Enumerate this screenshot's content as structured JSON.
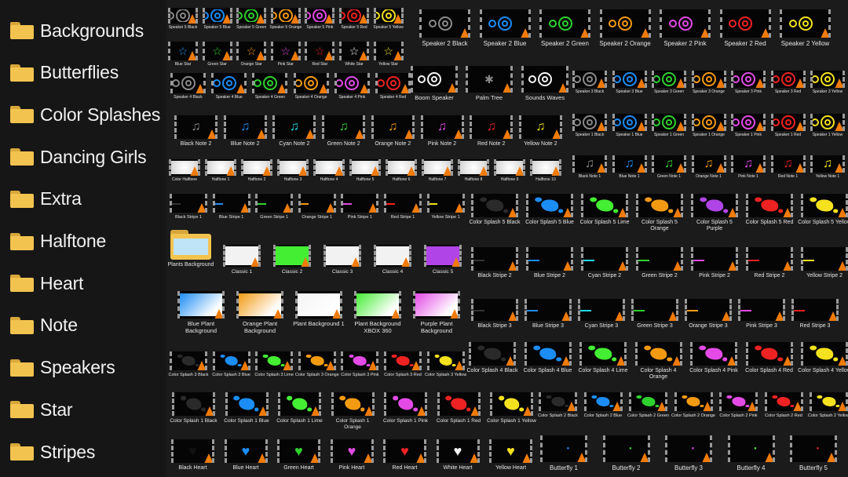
{
  "sidebar": {
    "folders": [
      "Backgrounds",
      "Butterflies",
      "Color Splashes",
      "Dancing Girls",
      "Extra",
      "Halftone",
      "Heart",
      "Note",
      "Speakers",
      "Star",
      "Stripes"
    ]
  },
  "colors": {
    "Black": "#0a0a0a",
    "Blue": "#1c8df5",
    "Green": "#2fd12f",
    "Orange": "#f39a12",
    "Pink": "#e34ae6",
    "Red": "#ee2222",
    "White": "#f4f4f4",
    "Yellow": "#f4e21e",
    "Cyan": "#22d8e8",
    "Lime": "#44ee33",
    "Purple": "#b144e6"
  },
  "tiles": [
    {
      "label": "Speaker 5 Black",
      "kind": "rings",
      "color": "Black"
    },
    {
      "label": "Speaker 5 Blue",
      "kind": "rings",
      "color": "Blue"
    },
    {
      "label": "Speaker 5 Green",
      "kind": "rings",
      "color": "Green"
    },
    {
      "label": "Speaker 5 Orange",
      "kind": "rings",
      "color": "Orange"
    },
    {
      "label": "Speaker 5 Pink",
      "kind": "rings",
      "color": "Pink"
    },
    {
      "label": "Speaker 5 Red",
      "kind": "rings",
      "color": "Red"
    },
    {
      "label": "Speaker 5 Yellow",
      "kind": "rings",
      "color": "Yellow"
    },
    {
      "label": "Blue Star",
      "kind": "star",
      "color": "Blue"
    },
    {
      "label": "Green Star",
      "kind": "star",
      "color": "Green"
    },
    {
      "label": "Orange Star",
      "kind": "star",
      "color": "Orange"
    },
    {
      "label": "Pink Star",
      "kind": "star",
      "color": "Pink"
    },
    {
      "label": "Red Star",
      "kind": "star",
      "color": "Red"
    },
    {
      "label": "White Star",
      "kind": "star",
      "color": "White"
    },
    {
      "label": "Yellow Star",
      "kind": "star",
      "color": "Yellow"
    },
    {
      "label": "Speaker 2 Black",
      "kind": "rings",
      "color": "Black"
    },
    {
      "label": "Speaker 2 Blue",
      "kind": "rings",
      "color": "Blue"
    },
    {
      "label": "Speaker 2 Green",
      "kind": "rings",
      "color": "Green"
    },
    {
      "label": "Speaker 2 Orange",
      "kind": "rings",
      "color": "Orange"
    },
    {
      "label": "Speaker 2 Pink",
      "kind": "rings",
      "color": "Pink"
    },
    {
      "label": "Speaker 2 Red",
      "kind": "rings",
      "color": "Red"
    },
    {
      "label": "Speaker 2 Yellow",
      "kind": "rings",
      "color": "Yellow"
    },
    {
      "label": "Speaker 4 Black",
      "kind": "rings",
      "color": "Black"
    },
    {
      "label": "Speaker 4 Blue",
      "kind": "rings",
      "color": "Blue"
    },
    {
      "label": "Speaker 4 Green",
      "kind": "rings",
      "color": "Green"
    },
    {
      "label": "Speaker 4 Orange",
      "kind": "rings",
      "color": "Orange"
    },
    {
      "label": "Speaker 4 Pink",
      "kind": "rings",
      "color": "Pink"
    },
    {
      "label": "Speaker 4 Red",
      "kind": "rings",
      "color": "Red"
    },
    {
      "label": "Boom Speaker",
      "kind": "rings",
      "color": "White"
    },
    {
      "label": "Palm Tree",
      "kind": "tree",
      "color": "White"
    },
    {
      "label": "Sounds Waves",
      "kind": "rings",
      "color": "White"
    },
    {
      "label": "Speaker 3 Black",
      "kind": "rings",
      "color": "Black"
    },
    {
      "label": "Speaker 3 Blue",
      "kind": "rings",
      "color": "Blue"
    },
    {
      "label": "Speaker 3 Green",
      "kind": "rings",
      "color": "Green"
    },
    {
      "label": "Speaker 3 Orange",
      "kind": "rings",
      "color": "Orange"
    },
    {
      "label": "Speaker 3 Pink",
      "kind": "rings",
      "color": "Pink"
    },
    {
      "label": "Speaker 3 Red",
      "kind": "rings",
      "color": "Red"
    },
    {
      "label": "Speaker 3 Yellow",
      "kind": "rings",
      "color": "Yellow"
    },
    {
      "label": "Black Note 2",
      "kind": "note",
      "color": "Black"
    },
    {
      "label": "Blue Note 2",
      "kind": "note",
      "color": "Blue"
    },
    {
      "label": "Cyan Note 2",
      "kind": "note",
      "color": "Cyan"
    },
    {
      "label": "Green Note 2",
      "kind": "note",
      "color": "Green"
    },
    {
      "label": "Orange Note 2",
      "kind": "note",
      "color": "Orange"
    },
    {
      "label": "Pink Note 2",
      "kind": "note",
      "color": "Pink"
    },
    {
      "label": "Red Note 2",
      "kind": "note",
      "color": "Red"
    },
    {
      "label": "Yellow Note 2",
      "kind": "note",
      "color": "Yellow"
    },
    {
      "label": "Speaker 1 Black",
      "kind": "rings",
      "color": "Black"
    },
    {
      "label": "Speaker 1 Blue",
      "kind": "rings",
      "color": "Blue"
    },
    {
      "label": "Speaker 1 Green",
      "kind": "rings",
      "color": "Green"
    },
    {
      "label": "Speaker 1 Orange",
      "kind": "rings",
      "color": "Orange"
    },
    {
      "label": "Speaker 1 Pink",
      "kind": "rings",
      "color": "Pink"
    },
    {
      "label": "Speaker 1 Red",
      "kind": "rings",
      "color": "Red"
    },
    {
      "label": "Speaker 1 Yellow",
      "kind": "rings",
      "color": "Yellow"
    },
    {
      "label": "Color Halftone",
      "kind": "half",
      "color": "White"
    },
    {
      "label": "Halftone 1",
      "kind": "half",
      "color": "White"
    },
    {
      "label": "Halftone 2",
      "kind": "half",
      "color": "White"
    },
    {
      "label": "Halftone 3",
      "kind": "half",
      "color": "White"
    },
    {
      "label": "Halftone 4",
      "kind": "half",
      "color": "White"
    },
    {
      "label": "Halftone 5",
      "kind": "half",
      "color": "White"
    },
    {
      "label": "Halftone 6",
      "kind": "half",
      "color": "White"
    },
    {
      "label": "Halftone 7",
      "kind": "half",
      "color": "White"
    },
    {
      "label": "Halftone 8",
      "kind": "half",
      "color": "White"
    },
    {
      "label": "Halftone 9",
      "kind": "half",
      "color": "White"
    },
    {
      "label": "Halftone 10",
      "kind": "half",
      "color": "White"
    },
    {
      "label": "Black Note 1",
      "kind": "note",
      "color": "Black"
    },
    {
      "label": "Blue Note 1",
      "kind": "note",
      "color": "Blue"
    },
    {
      "label": "Green Note 1",
      "kind": "note",
      "color": "Green"
    },
    {
      "label": "Orange Note 1",
      "kind": "note",
      "color": "Orange"
    },
    {
      "label": "Pink Note 1",
      "kind": "note",
      "color": "Pink"
    },
    {
      "label": "Red Note 1",
      "kind": "note",
      "color": "Red"
    },
    {
      "label": "Yellow Note 1",
      "kind": "note",
      "color": "Yellow"
    },
    {
      "label": "Black Stripe 1",
      "kind": "stripe",
      "color": "Black"
    },
    {
      "label": "Blue Stripe 1",
      "kind": "stripe",
      "color": "Blue"
    },
    {
      "label": "Green Stripe 1",
      "kind": "stripe",
      "color": "Green"
    },
    {
      "label": "Orange Stripe 1",
      "kind": "stripe",
      "color": "Orange"
    },
    {
      "label": "Pink Stripe 1",
      "kind": "stripe",
      "color": "Pink"
    },
    {
      "label": "Red Stripe 1",
      "kind": "stripe",
      "color": "Red"
    },
    {
      "label": "Yellow Stripe 1",
      "kind": "stripe",
      "color": "Yellow"
    },
    {
      "label": "Color Splash 5 Black",
      "kind": "splash",
      "color": "Black"
    },
    {
      "label": "Color Splash 5 Blue",
      "kind": "splash",
      "color": "Blue"
    },
    {
      "label": "Color Splash 5 Lime",
      "kind": "splash",
      "color": "Lime"
    },
    {
      "label": "Color Splash 5 Orange",
      "kind": "splash",
      "color": "Orange"
    },
    {
      "label": "Color Splash 5 Purple",
      "kind": "splash",
      "color": "Purple"
    },
    {
      "label": "Color Splash 5 Red",
      "kind": "splash",
      "color": "Red"
    },
    {
      "label": "Color Splash 5 Yellow",
      "kind": "splash",
      "color": "Yellow"
    },
    {
      "label": "Plants Background",
      "kind": "folder",
      "color": "White"
    },
    {
      "label": "Classic 1",
      "kind": "classic",
      "color": "White"
    },
    {
      "label": "Classic 2",
      "kind": "classic",
      "color": "Lime"
    },
    {
      "label": "Classic 3",
      "kind": "classic",
      "color": "White"
    },
    {
      "label": "Classic 4",
      "kind": "classic",
      "color": "White"
    },
    {
      "label": "Classic 5",
      "kind": "classic",
      "color": "Purple"
    },
    {
      "label": "Black Stripe 2",
      "kind": "stripe",
      "color": "Black"
    },
    {
      "label": "Blue Stripe 2",
      "kind": "stripe",
      "color": "Blue"
    },
    {
      "label": "Cyan Stripe 2",
      "kind": "stripe",
      "color": "Cyan"
    },
    {
      "label": "Green Stripe 2",
      "kind": "stripe",
      "color": "Green"
    },
    {
      "label": "Pink Stripe 2",
      "kind": "stripe",
      "color": "Pink"
    },
    {
      "label": "Red Stripe 2",
      "kind": "stripe",
      "color": "Red"
    },
    {
      "label": "Yellow Stripe 2",
      "kind": "stripe",
      "color": "Yellow"
    },
    {
      "label": "Blue Plant Background",
      "kind": "plant",
      "color": "Blue"
    },
    {
      "label": "Orange Plant Background",
      "kind": "plant",
      "color": "Orange"
    },
    {
      "label": "Plant Background 1",
      "kind": "plant",
      "color": "White"
    },
    {
      "label": "Plant Background XBOX 360",
      "kind": "plant",
      "color": "Lime"
    },
    {
      "label": "Purple Plant Background",
      "kind": "plant",
      "color": "Pink"
    },
    {
      "label": "Black Stripe 3",
      "kind": "stripe",
      "color": "Black"
    },
    {
      "label": "Blue Stripe 3",
      "kind": "stripe",
      "color": "Blue"
    },
    {
      "label": "Cyan Stripe 3",
      "kind": "stripe",
      "color": "Cyan"
    },
    {
      "label": "Green Stripe 3",
      "kind": "stripe",
      "color": "Green"
    },
    {
      "label": "Orange Stripe 3",
      "kind": "stripe",
      "color": "Orange"
    },
    {
      "label": "Pink Stripe 3",
      "kind": "stripe",
      "color": "Pink"
    },
    {
      "label": "Red Stripe 3",
      "kind": "stripe",
      "color": "Red"
    },
    {
      "label": "Color Splash 4 Black",
      "kind": "splash",
      "color": "Black"
    },
    {
      "label": "Color Splash 4 Blue",
      "kind": "splash",
      "color": "Blue"
    },
    {
      "label": "Color Splash 4 Lime",
      "kind": "splash",
      "color": "Lime"
    },
    {
      "label": "Color Splash 4 Orange",
      "kind": "splash",
      "color": "Orange"
    },
    {
      "label": "Color Splash 4 Pink",
      "kind": "splash",
      "color": "Pink"
    },
    {
      "label": "Color Splash 4 Red",
      "kind": "splash",
      "color": "Red"
    },
    {
      "label": "Color Splash 4 Yellow",
      "kind": "splash",
      "color": "Yellow"
    },
    {
      "label": "Color Splash 3 Black",
      "kind": "splash",
      "color": "Black"
    },
    {
      "label": "Color Splash 3 Blue",
      "kind": "splash",
      "color": "Blue"
    },
    {
      "label": "Color Splash 3 Lime",
      "kind": "splash",
      "color": "Lime"
    },
    {
      "label": "Color Splash 3 Orange",
      "kind": "splash",
      "color": "Orange"
    },
    {
      "label": "Color Splash 3 Pink",
      "kind": "splash",
      "color": "Pink"
    },
    {
      "label": "Color Splash 3 Red",
      "kind": "splash",
      "color": "Red"
    },
    {
      "label": "Color Splash 3 Yellow",
      "kind": "splash",
      "color": "Yellow"
    },
    {
      "label": "Color Splash 1 Black",
      "kind": "splash",
      "color": "Black"
    },
    {
      "label": "Color Splash 1 Blue",
      "kind": "splash",
      "color": "Blue"
    },
    {
      "label": "Color Splash 1 Lime",
      "kind": "splash",
      "color": "Lime"
    },
    {
      "label": "Color Splash 1 Orange",
      "kind": "splash",
      "color": "Orange"
    },
    {
      "label": "Color Splash 1 Pink",
      "kind": "splash",
      "color": "Pink"
    },
    {
      "label": "Color Splash 1 Red",
      "kind": "splash",
      "color": "Red"
    },
    {
      "label": "Color Splash 1 Yellow",
      "kind": "splash",
      "color": "Yellow"
    },
    {
      "label": "Color Splash 2 Black",
      "kind": "splash",
      "color": "Black"
    },
    {
      "label": "Color Splash 2 Blue",
      "kind": "splash",
      "color": "Blue"
    },
    {
      "label": "Color Splash 2 Green",
      "kind": "splash",
      "color": "Green"
    },
    {
      "label": "Color Splash 2 Orange",
      "kind": "splash",
      "color": "Orange"
    },
    {
      "label": "Color Splash 2 Pink",
      "kind": "splash",
      "color": "Pink"
    },
    {
      "label": "Color Splash 2 Red",
      "kind": "splash",
      "color": "Red"
    },
    {
      "label": "Color Splash 2 Yellow",
      "kind": "splash",
      "color": "Yellow"
    },
    {
      "label": "Black Heart",
      "kind": "heart",
      "color": "Black"
    },
    {
      "label": "Blue Heart",
      "kind": "heart",
      "color": "Blue"
    },
    {
      "label": "Green Heart",
      "kind": "heart",
      "color": "Green"
    },
    {
      "label": "Pink Heart",
      "kind": "heart",
      "color": "Pink"
    },
    {
      "label": "Red Heart",
      "kind": "heart",
      "color": "Red"
    },
    {
      "label": "White Heart",
      "kind": "heart",
      "color": "White"
    },
    {
      "label": "Yellow Heart",
      "kind": "heart",
      "color": "Yellow"
    },
    {
      "label": "Butterfly 1",
      "kind": "butterfly",
      "color": "Blue"
    },
    {
      "label": "Butterfly 2",
      "kind": "butterfly",
      "color": "Green"
    },
    {
      "label": "Butterfly 3",
      "kind": "butterfly",
      "color": "Pink"
    },
    {
      "label": "Butterfly 4",
      "kind": "butterfly",
      "color": "Lime"
    },
    {
      "label": "Butterfly 5",
      "kind": "butterfly",
      "color": "Red"
    }
  ]
}
